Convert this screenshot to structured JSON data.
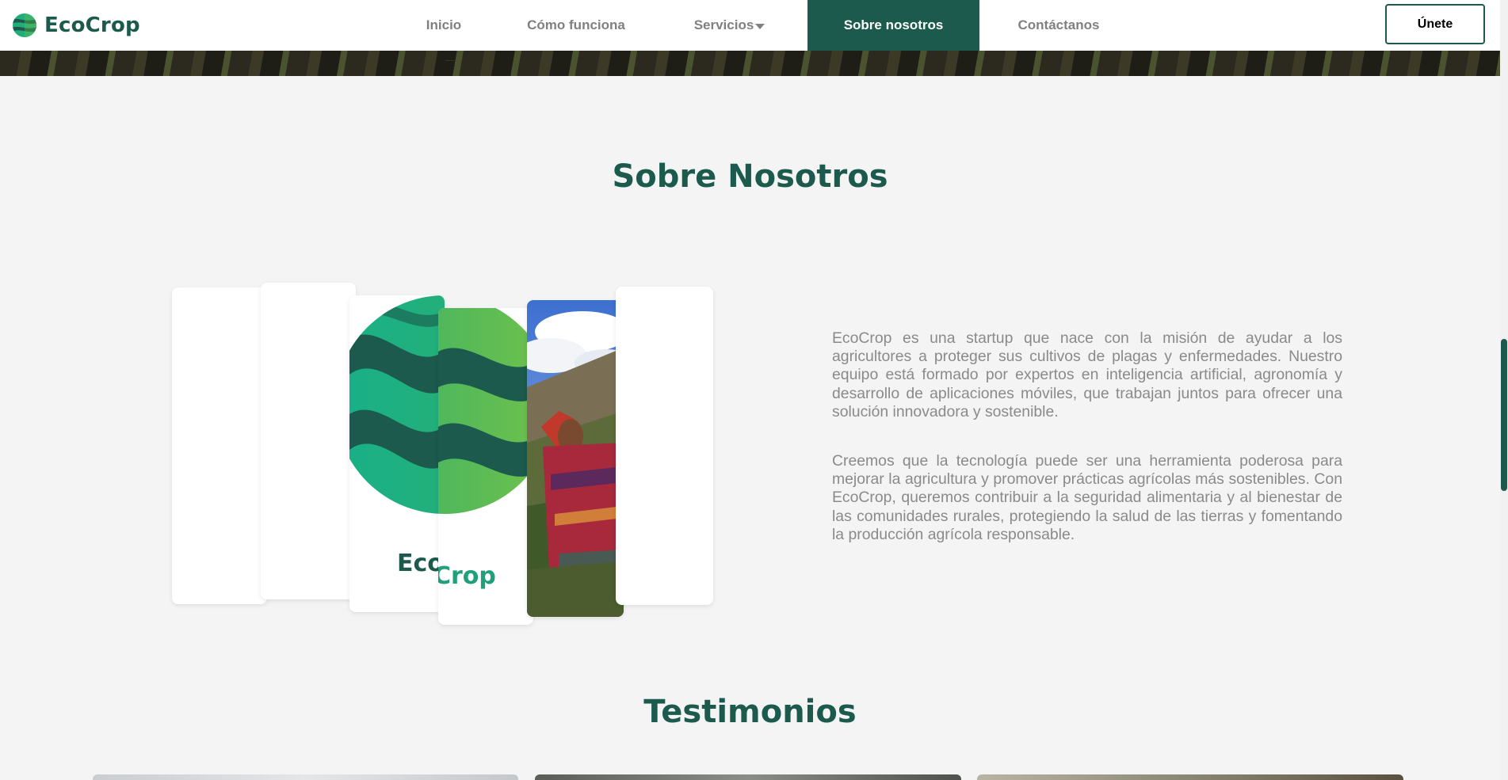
{
  "brand": {
    "name": "EcoCrop",
    "logo_icon": "globe-leaf-icon"
  },
  "nav": {
    "items": [
      {
        "label": "Inicio",
        "active": false
      },
      {
        "label": "Cómo funciona",
        "active": false
      },
      {
        "label": "Servicios",
        "active": false,
        "has_dropdown": true
      },
      {
        "label": "Sobre nosotros",
        "active": true
      },
      {
        "label": "Contáctanos",
        "active": false
      }
    ],
    "cta_label": "Únete"
  },
  "about": {
    "title": "Sobre Nosotros",
    "paragraphs": [
      "EcoCrop es una startup que nace con la misión de ayudar a los agricultores a proteger sus cultivos de plagas y enfermedades. Nuestro equipo está formado por expertos en inteligencia artificial, agronomía y desarrollo de aplicaciones móviles, que trabajan juntos para ofrecer una solución innovadora y sostenible.",
      "Creemos que la tecnología puede ser una herramienta poderosa para mejorar la agricultura y promover prácticas agrícolas más sostenibles. Con EcoCrop, queremos contribuir a la seguridad alimentaria y al bienestar de las comunidades rurales, protegiendo la salud de las tierras y fomentando la producción agrícola responsable."
    ],
    "gallery_logo_text": "EcoCrop"
  },
  "testimonials": {
    "title": "Testimonios"
  },
  "colors": {
    "brand": "#1b5a4c",
    "accent": "#28a878",
    "text_muted": "#8a8a8a",
    "background": "#f4f4f4"
  }
}
